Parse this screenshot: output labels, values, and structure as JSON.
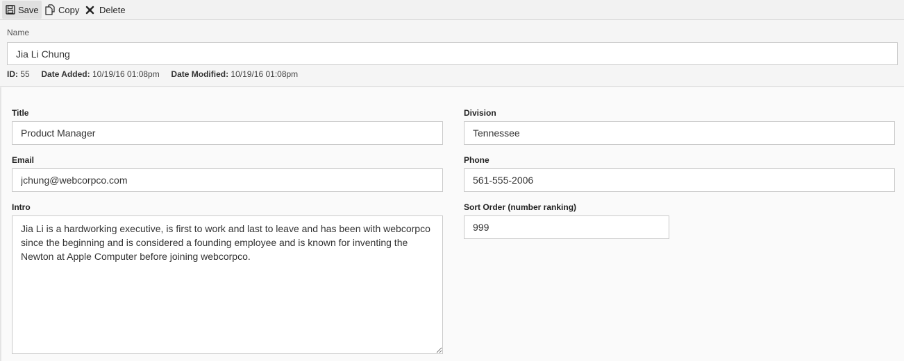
{
  "toolbar": {
    "save_label": "Save",
    "copy_label": "Copy",
    "delete_label": "Delete",
    "icons": {
      "save": "floppy-disk-icon",
      "copy": "copy-icon",
      "delete": "x-icon"
    }
  },
  "record": {
    "name_label": "Name",
    "name_value": "Jia Li Chung",
    "id_label": "ID:",
    "id_value": "55",
    "date_added_label": "Date Added:",
    "date_added_value": "10/19/16 01:08pm",
    "date_modified_label": "Date Modified:",
    "date_modified_value": "10/19/16 01:08pm"
  },
  "fields": {
    "title": {
      "label": "Title",
      "value": "Product Manager"
    },
    "division": {
      "label": "Division",
      "value": "Tennessee"
    },
    "email": {
      "label": "Email",
      "value": "jchung@webcorpco.com"
    },
    "phone": {
      "label": "Phone",
      "value": "561-555-2006"
    },
    "intro": {
      "label": "Intro",
      "value": "Jia Li is a hardworking executive, is first to work and last to leave and has been with webcorpco since the beginning and is considered a founding employee and is known for inventing the Newton at Apple Computer before joining webcorpco."
    },
    "sort_order": {
      "label": "Sort Order (number ranking)",
      "value": "999"
    }
  }
}
